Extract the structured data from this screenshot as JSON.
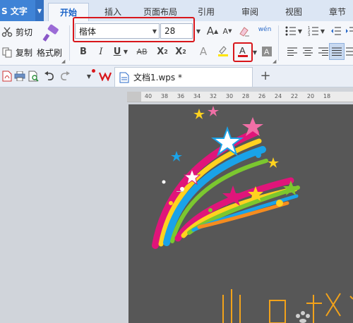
{
  "app": {
    "name": "S 文字"
  },
  "tabs": [
    "开始",
    "插入",
    "页面布局",
    "引用",
    "审阅",
    "视图",
    "章节"
  ],
  "clipboard": {
    "cut_label": "剪切",
    "copy_label": "复制",
    "format_painter_label": "格式刷"
  },
  "font": {
    "name": "楷体",
    "size": "28",
    "grow_label": "A",
    "shrink_label": "A"
  },
  "format_buttons": {
    "bold": "B",
    "italic": "I",
    "underline": "U",
    "strike": "AB",
    "superscript": "X",
    "subscript": "X"
  },
  "pinyin_label": "wén",
  "document": {
    "tab_title": "文档1.wps *"
  },
  "ruler": {
    "ticks": [
      "40",
      "38",
      "36",
      "34",
      "32",
      "30",
      "28",
      "26",
      "24",
      "22",
      "20",
      "18"
    ]
  },
  "colors": {
    "accent": "#1a63c8",
    "app_blue": "#3f83d6",
    "highlight_box": "#d8161b",
    "page_bg": "#575757",
    "font_color_bar": "#d8161b"
  },
  "icons": [
    "scissors-icon",
    "copy-icon",
    "format-painter-icon",
    "clear-format-icon",
    "pdf-icon",
    "print-icon",
    "print-preview-icon",
    "undo-icon",
    "redo-icon",
    "wps-logo-icon",
    "document-icon",
    "new-tab-icon"
  ]
}
